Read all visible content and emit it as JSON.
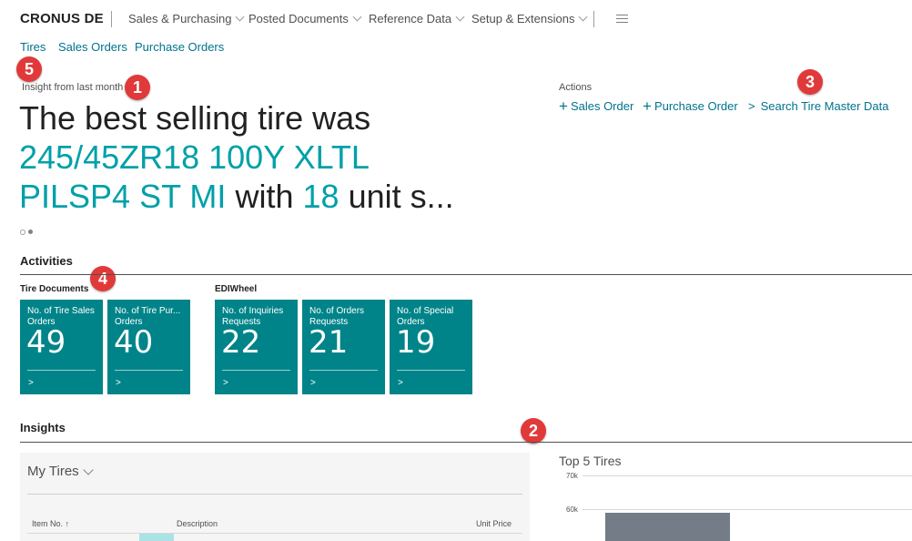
{
  "nav": {
    "brand": "CRONUS DE",
    "menus": [
      "Sales & Purchasing",
      "Posted Documents",
      "Reference Data",
      "Setup & Extensions"
    ],
    "hamburger_icon": "hamburger-menu-icon"
  },
  "subnav": [
    "Tires",
    "Sales Orders",
    "Purchase Orders"
  ],
  "badges": [
    "1",
    "2",
    "3",
    "4",
    "5"
  ],
  "headline": {
    "caption": "Insight from last month",
    "prefix": "The best selling tire was",
    "product": "245/45ZR18 100Y XLTL PILSP4 ST MI",
    "middle": "with",
    "count": "18",
    "suffix": "unit s..."
  },
  "actions": {
    "caption": "Actions",
    "items": [
      "Sales Order",
      "Purchase Order",
      "Search Tire Master Data"
    ]
  },
  "activities": {
    "title": "Activities",
    "groups": [
      {
        "title": "Tire Documents",
        "tiles": [
          {
            "label": "No. of Tire Sales Orders",
            "value": "49"
          },
          {
            "label": "No. of Tire Pur... Orders",
            "value": "40"
          }
        ]
      },
      {
        "title": "EDIWheel",
        "tiles": [
          {
            "label": "No. of Inquiries Requests",
            "value": "22"
          },
          {
            "label": "No. of Orders Requests",
            "value": "21"
          },
          {
            "label": "No. of Special Orders",
            "value": "19"
          }
        ]
      }
    ],
    "tile_arrow": ">"
  },
  "insights": {
    "title": "Insights",
    "my_tires": {
      "title": "My Tires",
      "columns": [
        "Item No. ↑",
        "Description",
        "Unit Price"
      ]
    }
  },
  "chart_data": {
    "type": "bar",
    "title": "Top 5 Tires",
    "y_ticks": [
      "70k",
      "60k"
    ],
    "ylim": [
      0,
      70000
    ],
    "categories": [
      ""
    ],
    "values": [
      59000
    ]
  },
  "colors": {
    "accent": "#00738c",
    "highlight": "#00a0a8",
    "tile": "#008489",
    "badge": "#e13939",
    "bar": "#737c87"
  }
}
